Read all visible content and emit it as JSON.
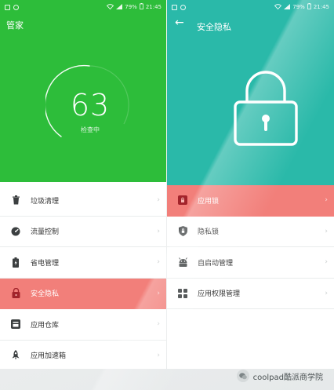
{
  "left": {
    "status": {
      "battery": "79%",
      "time": "21:45"
    },
    "title": "管家",
    "score": "63",
    "score_caption": "检查中",
    "menu": [
      {
        "label": "垃圾清理",
        "icon": "trash-icon",
        "highlight": false
      },
      {
        "label": "流量控制",
        "icon": "gauge-icon",
        "highlight": false
      },
      {
        "label": "省电管理",
        "icon": "battery-icon",
        "highlight": false
      },
      {
        "label": "安全隐私",
        "icon": "lock-icon",
        "highlight": true
      },
      {
        "label": "应用仓库",
        "icon": "app-store-icon",
        "highlight": false
      },
      {
        "label": "应用加速箱",
        "icon": "rocket-icon",
        "highlight": false
      }
    ]
  },
  "right": {
    "status": {
      "battery": "79%",
      "time": "21:45"
    },
    "title": "安全隐私",
    "menu": [
      {
        "label": "应用锁",
        "icon": "app-lock-icon",
        "highlight": true
      },
      {
        "label": "隐私锁",
        "icon": "shield-icon",
        "highlight": false
      },
      {
        "label": "自启动管理",
        "icon": "android-icon",
        "highlight": false
      },
      {
        "label": "应用权限管理",
        "icon": "grid-icon",
        "highlight": false
      }
    ]
  },
  "watermark": "coolpad酷派商学院",
  "colors": {
    "green": "#2dbd3a",
    "teal": "#2ab9a9",
    "highlight": "#f27f7a"
  }
}
